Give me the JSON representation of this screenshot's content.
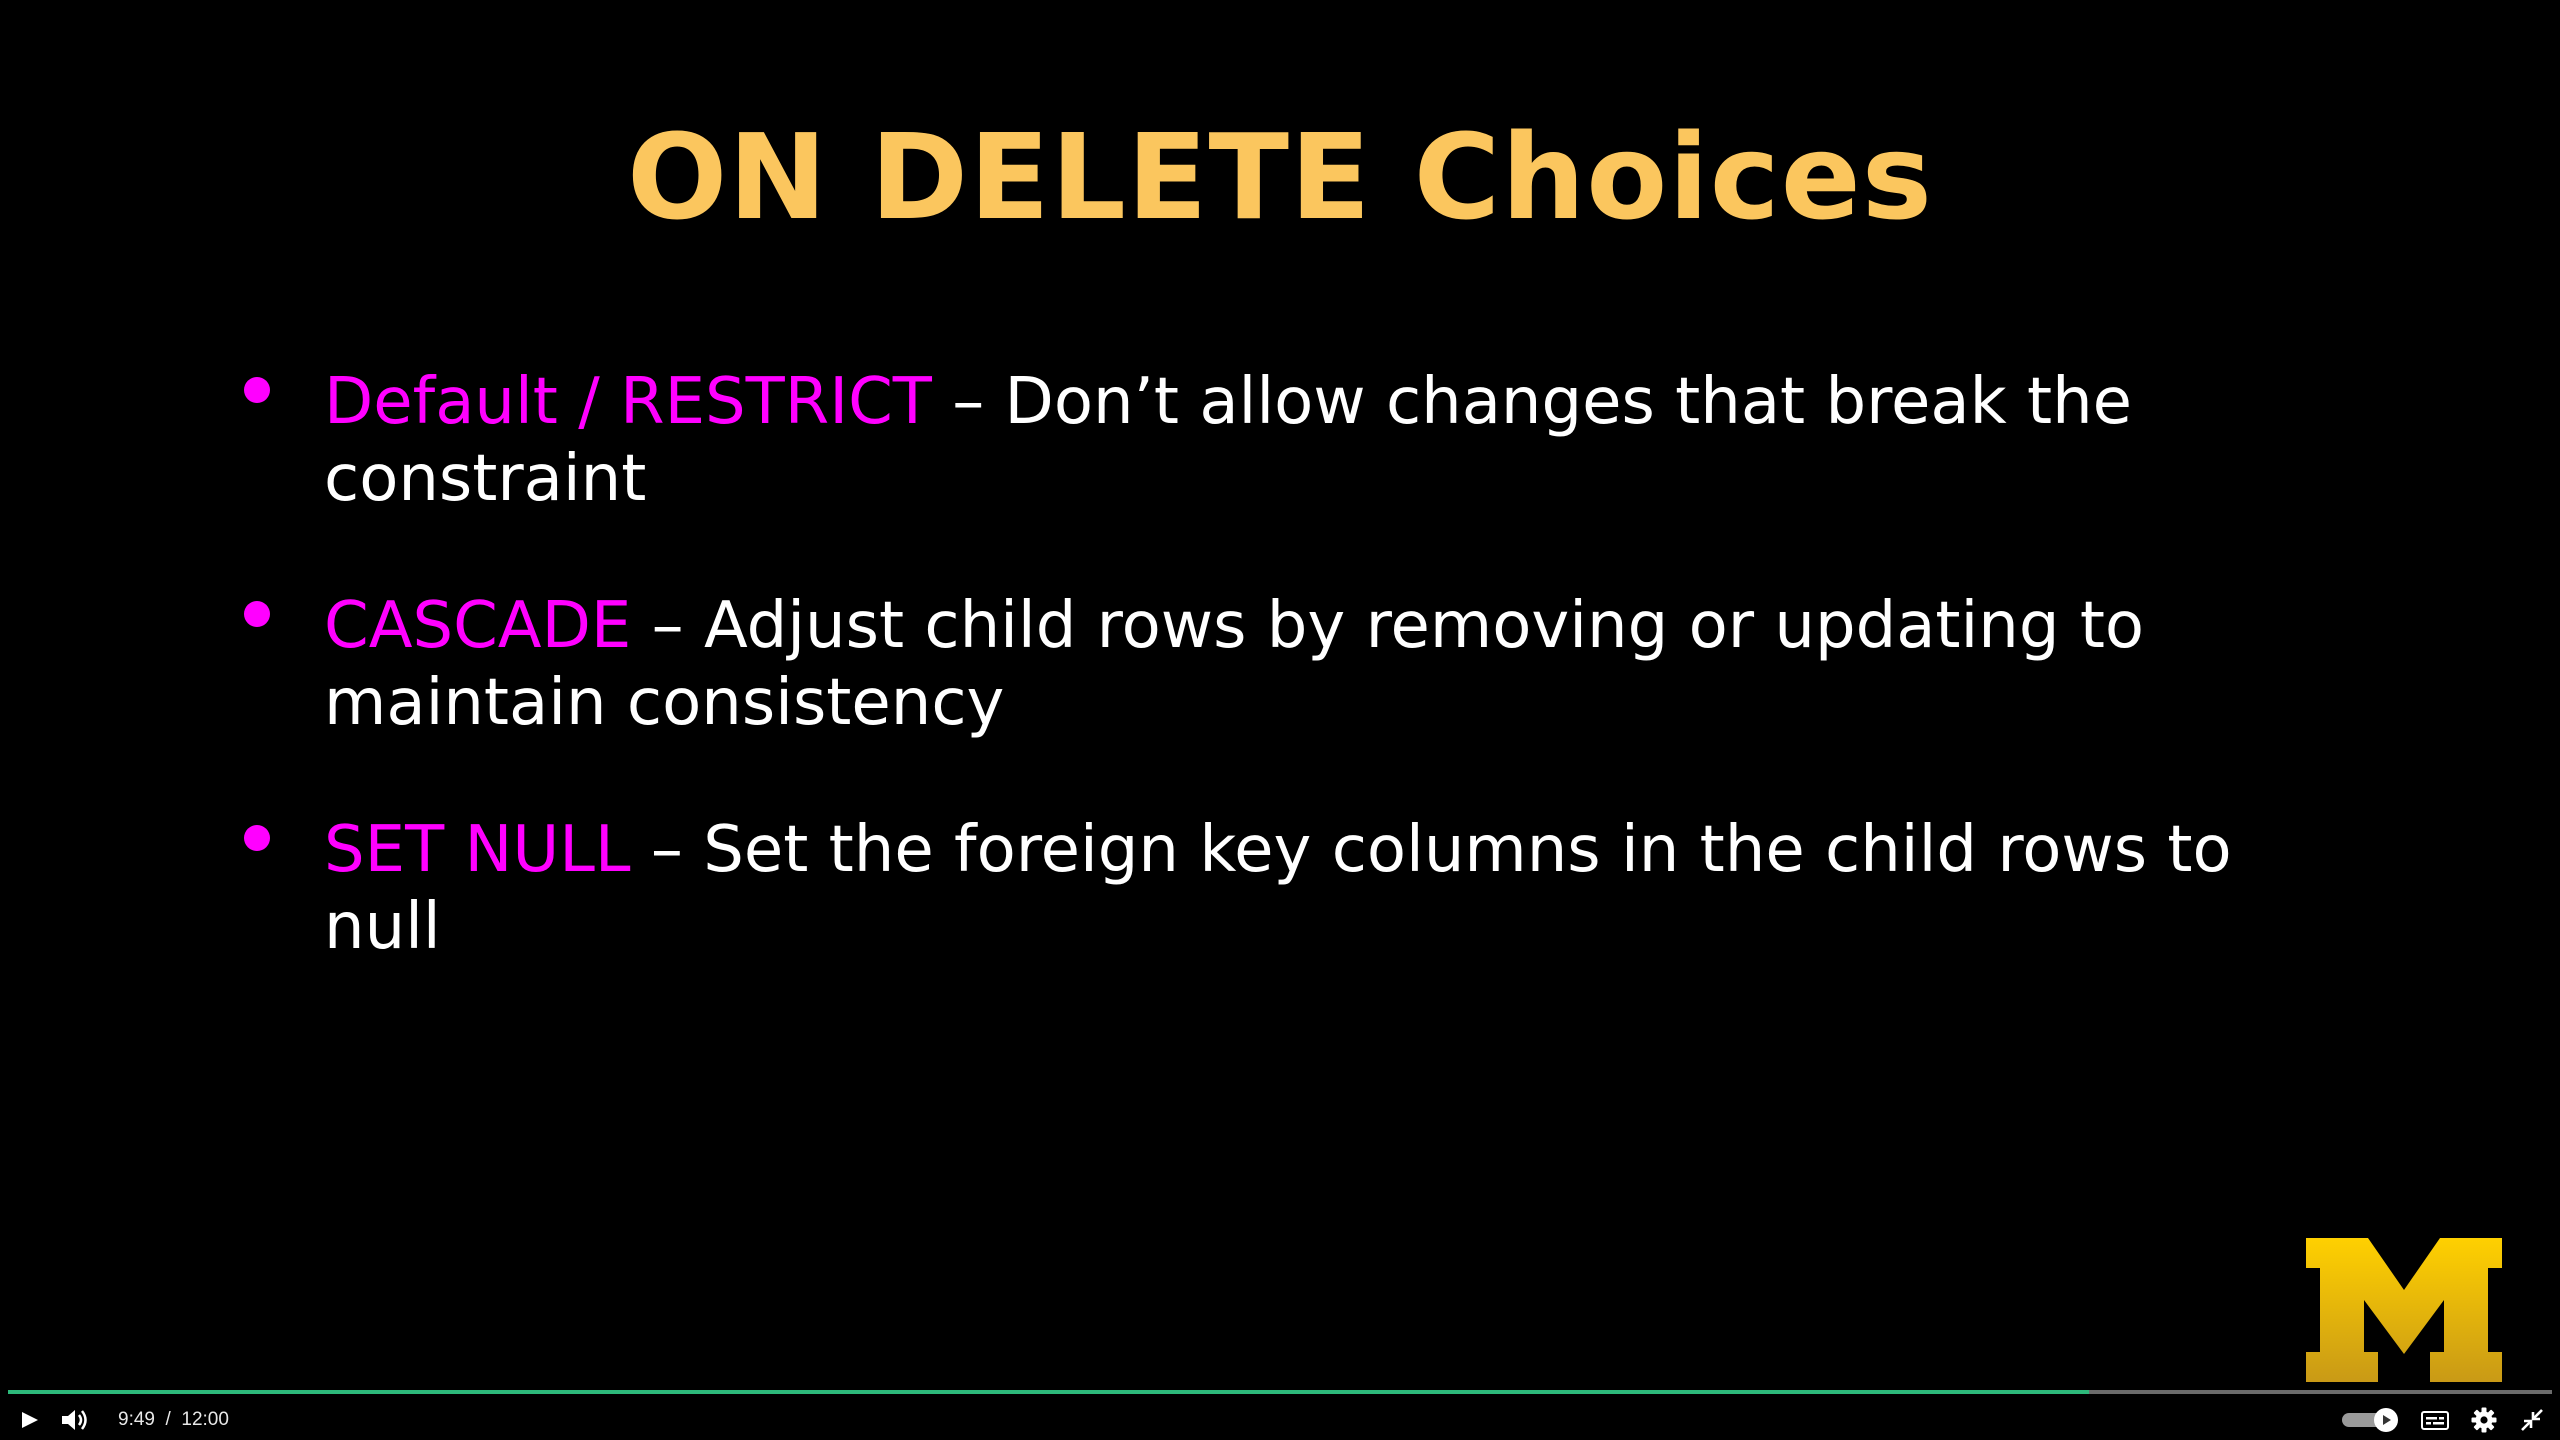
{
  "slide": {
    "title": "ON DELETE Choices",
    "bullets": [
      {
        "term": "Default / RESTRICT",
        "line1": " – Don’t allow changes that break the",
        "line2": "constraint"
      },
      {
        "term": "CASCADE",
        "line1": " – Adjust child rows by removing or updating to",
        "line2": "maintain consistency"
      },
      {
        "term": "SET NULL",
        "line1": " – Set the foreign key columns in the child rows to",
        "line2": "null"
      }
    ],
    "logo_letter": "M",
    "logo_icon": "university-block-m-logo"
  },
  "player": {
    "current_time": "9:49",
    "separator": "/",
    "duration": "12:00",
    "progress_fraction": 0.818,
    "icons": [
      "play-icon",
      "volume-icon",
      "autoplay-toggle",
      "captions-icon",
      "settings-icon",
      "exit-fullscreen-icon"
    ]
  },
  "colors": {
    "title": "#fbc65e",
    "term": "#ff00ff",
    "body_text": "#ffffff",
    "bullet": "#ff00ff",
    "logo": "#f5c518",
    "progress": "#2db87a"
  }
}
